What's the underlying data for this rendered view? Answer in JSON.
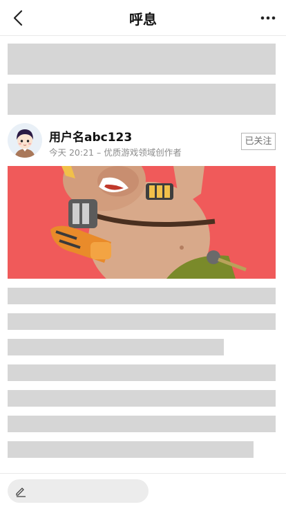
{
  "header": {
    "title": "呼息",
    "back_icon": "back-arrow-icon",
    "more_icon": "more-dots-icon"
  },
  "author": {
    "username": "用户名abc123",
    "meta": "今天 20:21 – 优质游戏领域创作者",
    "follow_label": "已关注"
  },
  "colors": {
    "banner_bg": "#f05a5a",
    "skeleton": "#d6d6d6"
  },
  "bottom_bar": {
    "comment_icon": "pencil-icon"
  }
}
